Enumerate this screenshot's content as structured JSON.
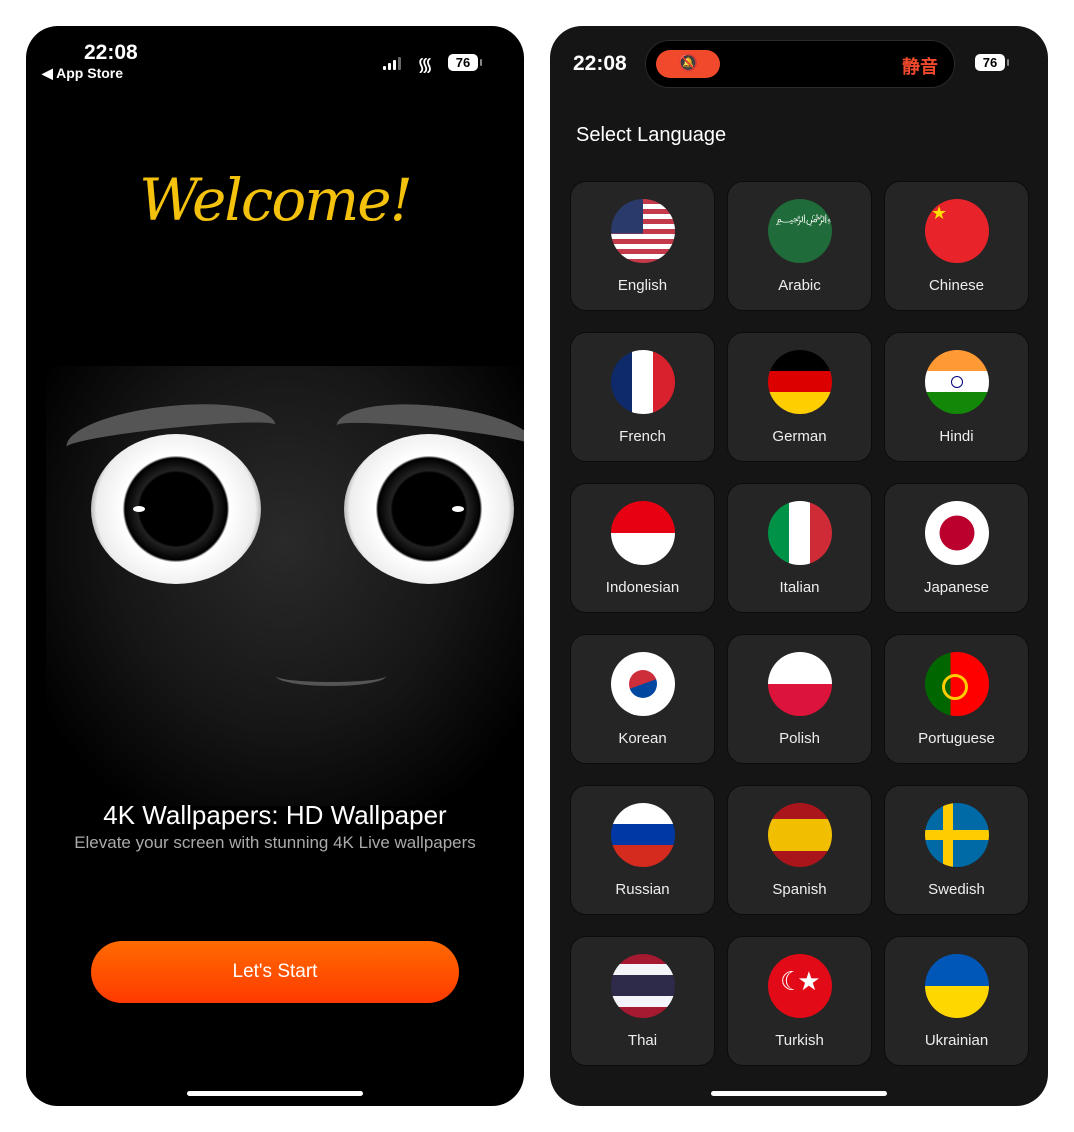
{
  "welcome_screen": {
    "status": {
      "time": "22:08",
      "back": "◀ App Store",
      "battery": "76"
    },
    "welcome_text": "Welcome!",
    "title": "4K Wallpapers: HD Wallpaper",
    "subtitle": "Elevate your screen with stunning 4K Live wallpapers",
    "start_label": "Let's Start"
  },
  "language_screen": {
    "status": {
      "time": "22:08",
      "mute_icon": "🔕",
      "mute_text": "静音",
      "battery": "76"
    },
    "title": "Select Language",
    "languages": [
      {
        "label": "English",
        "icon": "us-flag-icon"
      },
      {
        "label": "Arabic",
        "icon": "saudi-flag-icon"
      },
      {
        "label": "Chinese",
        "icon": "china-flag-icon"
      },
      {
        "label": "French",
        "icon": "france-flag-icon"
      },
      {
        "label": "German",
        "icon": "germany-flag-icon"
      },
      {
        "label": "Hindi",
        "icon": "india-flag-icon"
      },
      {
        "label": "Indonesian",
        "icon": "indonesia-flag-icon"
      },
      {
        "label": "Italian",
        "icon": "italy-flag-icon"
      },
      {
        "label": "Japanese",
        "icon": "japan-flag-icon"
      },
      {
        "label": "Korean",
        "icon": "korea-flag-icon"
      },
      {
        "label": "Polish",
        "icon": "poland-flag-icon"
      },
      {
        "label": "Portuguese",
        "icon": "portugal-flag-icon"
      },
      {
        "label": "Russian",
        "icon": "russia-flag-icon"
      },
      {
        "label": "Spanish",
        "icon": "spain-flag-icon"
      },
      {
        "label": "Swedish",
        "icon": "sweden-flag-icon"
      },
      {
        "label": "Thai",
        "icon": "thailand-flag-icon"
      },
      {
        "label": "Turkish",
        "icon": "turkey-flag-icon"
      },
      {
        "label": "Ukrainian",
        "icon": "ukraine-flag-icon"
      }
    ]
  },
  "colors": {
    "accent": "#ff4a00",
    "mute": "#f0492c",
    "welcome": "#f4c20d"
  }
}
